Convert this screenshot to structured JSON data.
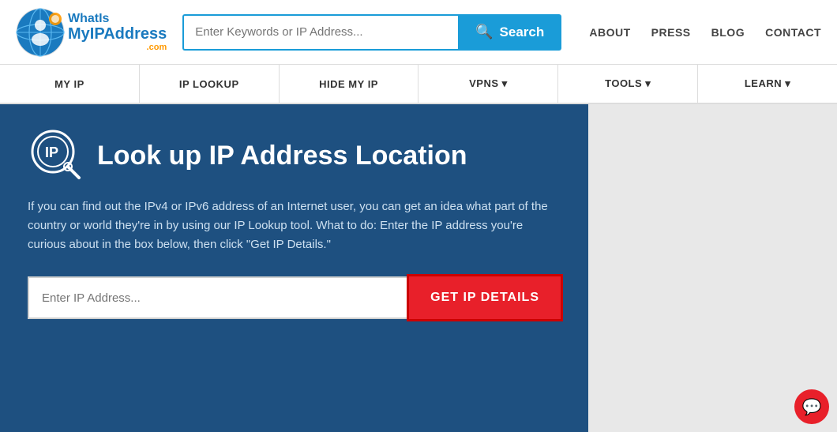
{
  "header": {
    "logo": {
      "what_is": "WhatIs",
      "myip": "MyIP",
      "address": "Address",
      "dot_com": ".com"
    },
    "search": {
      "placeholder": "Enter Keywords or IP Address...",
      "button_label": "Search"
    },
    "nav_links": [
      {
        "label": "ABOUT",
        "href": "#"
      },
      {
        "label": "PRESS",
        "href": "#"
      },
      {
        "label": "BLOG",
        "href": "#"
      },
      {
        "label": "CONTACT",
        "href": "#"
      }
    ]
  },
  "nav_bar": {
    "items": [
      {
        "label": "MY IP"
      },
      {
        "label": "IP LOOKUP"
      },
      {
        "label": "HIDE MY IP"
      },
      {
        "label": "VPNS ▾"
      },
      {
        "label": "TOOLS ▾"
      },
      {
        "label": "LEARN ▾"
      }
    ]
  },
  "main": {
    "panel_title": "Look up IP Address Location",
    "panel_description": "If you can find out the IPv4 or IPv6 address of an Internet user, you can get an idea what part of the country or world they're in by using our IP Lookup tool. What to do: Enter the IP address you're curious about in the box below, then click \"Get IP Details.\"",
    "ip_input_placeholder": "Enter IP Address...",
    "get_details_label": "GET IP DETAILS"
  }
}
